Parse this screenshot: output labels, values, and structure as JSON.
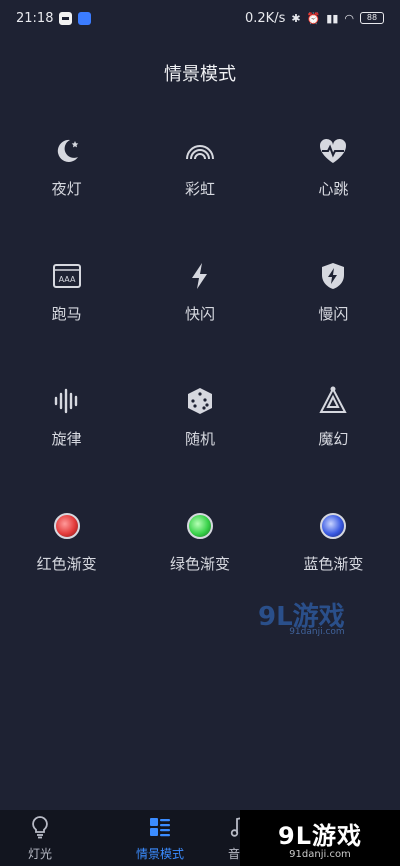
{
  "status_bar": {
    "time": "21:18",
    "net_speed": "0.2K/s",
    "battery": "88"
  },
  "page": {
    "title": "情景模式"
  },
  "modes": [
    {
      "label": "夜灯",
      "icon": "moon-star-icon"
    },
    {
      "label": "彩虹",
      "icon": "rainbow-icon"
    },
    {
      "label": "心跳",
      "icon": "heartbeat-icon"
    },
    {
      "label": "跑马",
      "icon": "marquee-icon"
    },
    {
      "label": "快闪",
      "icon": "lightning-icon"
    },
    {
      "label": "慢闪",
      "icon": "shield-lightning-icon"
    },
    {
      "label": "旋律",
      "icon": "sound-wave-icon"
    },
    {
      "label": "随机",
      "icon": "dice-icon"
    },
    {
      "label": "魔幻",
      "icon": "magic-triangle-icon"
    },
    {
      "label": "红色渐变",
      "icon": "red-gradient-dot-icon",
      "color": "#e23a3a"
    },
    {
      "label": "绿色渐变",
      "icon": "green-gradient-dot-icon",
      "color": "#39d24a"
    },
    {
      "label": "蓝色渐变",
      "icon": "blue-gradient-dot-icon",
      "color": "#3a5ae2"
    }
  ],
  "watermark": {
    "brand": "9L游戏",
    "site": "91danji.com"
  },
  "bottom_nav": [
    {
      "label": "灯光",
      "icon": "light-bulb-icon",
      "active": false
    },
    {
      "label": "情景模式",
      "icon": "scene-list-icon",
      "active": true
    },
    {
      "label": "音乐",
      "icon": "music-note-icon",
      "active": false
    }
  ],
  "colors": {
    "background": "#1e2233",
    "accent": "#3b8cff",
    "nav_bg": "#12151f"
  }
}
